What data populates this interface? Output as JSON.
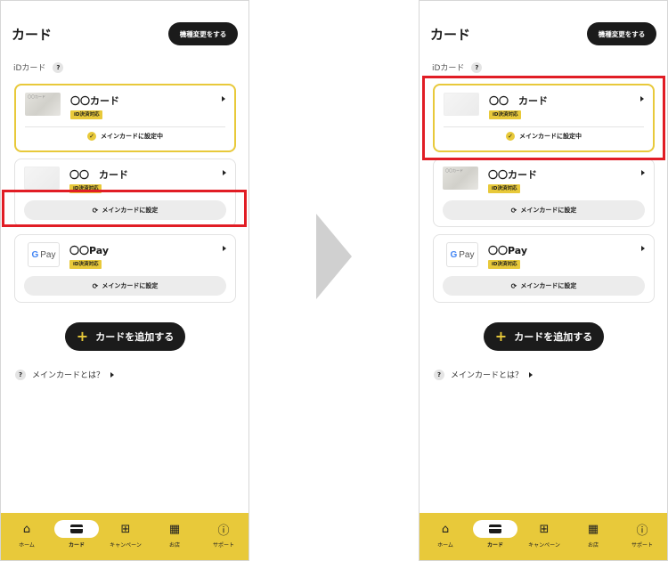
{
  "left": {
    "title": "カード",
    "change_button": "機種変更をする",
    "section_label": "iDカード",
    "cards": [
      {
        "thumb_text": "〇〇カード",
        "name": "〇〇カード",
        "badge": "iD決済対応",
        "status": "メインカードに設定中"
      },
      {
        "name": "〇〇　カード",
        "badge": "iD決済対応",
        "action": "メインカードに設定"
      },
      {
        "logo": "G Pay",
        "name": "〇〇Pay",
        "badge": "iD決済対応",
        "action": "メインカードに設定"
      }
    ],
    "add_button": "カードを追加する",
    "what_link": "メインカードとは？"
  },
  "right": {
    "title": "カード",
    "change_button": "機種変更をする",
    "section_label": "iDカード",
    "cards": [
      {
        "name": "〇〇　カード",
        "badge": "iD決済対応",
        "status": "メインカードに設定中"
      },
      {
        "thumb_text": "〇〇カード",
        "name": "〇〇カード",
        "badge": "iD決済対応",
        "action": "メインカードに設定"
      },
      {
        "logo": "G Pay",
        "name": "〇〇Pay",
        "badge": "iD決済対応",
        "action": "メインカードに設定"
      }
    ],
    "add_button": "カードを追加する",
    "what_link": "メインカードとは？"
  },
  "help_icon": "?",
  "tabs": [
    {
      "label": "ホーム",
      "icon": "home-icon"
    },
    {
      "label": "カード",
      "icon": "card-icon",
      "active": true
    },
    {
      "label": "キャンペーン",
      "icon": "gift-icon"
    },
    {
      "label": "お店",
      "icon": "store-icon"
    },
    {
      "label": "サポート",
      "icon": "help-icon"
    }
  ],
  "colors": {
    "accent": "#e8c93a",
    "highlight": "#e11d25",
    "dark": "#1b1b1b"
  }
}
